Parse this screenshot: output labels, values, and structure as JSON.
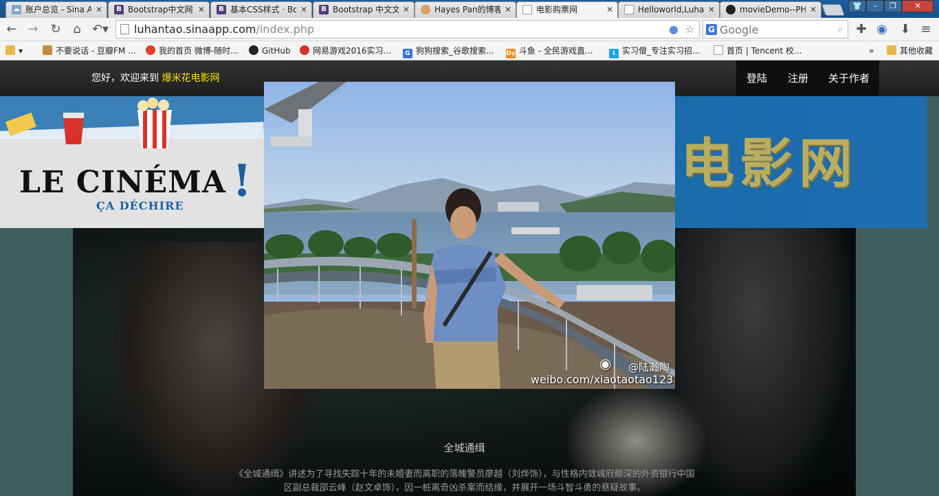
{
  "tabs": [
    {
      "title": "账户总览 - Sina A",
      "favicon": "cloud-favicon",
      "color": "#7aa8d8",
      "active": false
    },
    {
      "title": "Bootstrap中文网",
      "favicon": "bootstrap-favicon",
      "color": "#563d7c",
      "letter": "B",
      "active": false
    },
    {
      "title": "基本CSS样式 · Bo",
      "favicon": "bootstrap-favicon",
      "color": "#563d7c",
      "letter": "B",
      "active": false
    },
    {
      "title": "Bootstrap 中文文",
      "favicon": "bootstrap-favicon",
      "color": "#563d7c",
      "letter": "B",
      "active": false
    },
    {
      "title": "Hayes Pan的博客",
      "favicon": "avatar-favicon",
      "color": "#d9a06a",
      "active": false
    },
    {
      "title": "电影购票网",
      "favicon": "page-favicon",
      "color": "#ffffff",
      "active": true
    },
    {
      "title": "Helloworld,Luha",
      "favicon": "page-favicon",
      "color": "#ffffff",
      "active": false
    },
    {
      "title": "movieDemo--PH",
      "favicon": "github-favicon",
      "color": "#222222",
      "active": false
    }
  ],
  "toolbar": {
    "url_host": "luhantao.sinaapp.com",
    "url_path": "/index.php",
    "search_placeholder": "Google"
  },
  "bookmarks": [
    {
      "label": "",
      "icon": "bookmark-folder-icon"
    },
    {
      "label": "不要说话 - 豆瓣FM ...",
      "icon": "douban-icon",
      "color": "#c48b3a"
    },
    {
      "label": "我的首页 微博-随时...",
      "icon": "weibo-icon",
      "color": "#e23d2d"
    },
    {
      "label": "GitHub",
      "icon": "github-icon",
      "color": "#222222"
    },
    {
      "label": "网易游戏2016实习...",
      "icon": "netease-icon",
      "color": "#d8322a"
    },
    {
      "label": "狗狗搜索_谷歌搜索...",
      "icon": "gougou-icon",
      "color": "#3b73d1"
    },
    {
      "label": "斗鱼 - 全民游戏直...",
      "icon": "douyu-icon",
      "color": "#f28a1c"
    },
    {
      "label": "实习僧_专注实习招...",
      "icon": "shixiseng-icon",
      "color": "#1aa5e6"
    },
    {
      "label": "首页 | Tencent 校...",
      "icon": "page-icon",
      "color": "#ffffff"
    },
    {
      "label": "»",
      "icon": ""
    },
    {
      "label": "其他收藏",
      "icon": "folder-icon",
      "color": "#e8b84a"
    }
  ],
  "site": {
    "welcome_prefix": "您好，欢迎来到",
    "welcome_site": "爆米花电影网",
    "nav": [
      "登陆",
      "注册",
      "关于作者"
    ]
  },
  "banner": {
    "logo_main": "LE CINÉMA",
    "logo_sub": "ÇA DÉCHIRE",
    "logo_mark": "!",
    "chinese_title": "电影网"
  },
  "hero": {
    "movie_title": "全城通缉",
    "movie_description": "《全城通缉》讲述为了寻找失踪十年的未婚妻而离职的落魄警员廖越（刘烨饰），与性格内敛城府颇深的外资银行中国区副总裁邵云峰（赵文卓饰），因一桩离奇凶杀案而结缘，并展开一场斗智斗勇的悬疑故事。"
  },
  "modal": {
    "watermark_name": "@陆瀚陶",
    "watermark_url": "weibo.com/xiaotaotao123"
  }
}
